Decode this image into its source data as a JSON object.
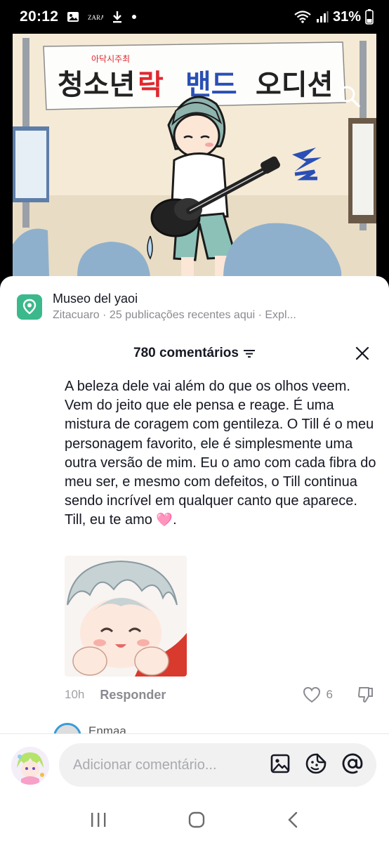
{
  "status_bar": {
    "time": "20:12",
    "battery": "31%",
    "icons": [
      "gallery-icon",
      "zara-icon",
      "download-icon",
      "dot-icon",
      "wifi-icon",
      "signal-icon",
      "battery-icon"
    ]
  },
  "video": {
    "banner_small": "아닥시주최",
    "banner_words": [
      "청소년",
      "락",
      "밴드",
      "오디션"
    ],
    "search_icon": "search-icon"
  },
  "place": {
    "title": "Museo del yaoi",
    "subtitle": "Zitacuaro · 25 publicações recentes aqui · Expl..."
  },
  "comments_header": {
    "title": "780 comentários",
    "sort_icon": "sort-icon",
    "close_icon": "close-icon"
  },
  "comment": {
    "text": "A beleza dele vai além do que os olhos veem. Vem do jeito que ele pensa e reage. É uma mistura de coragem com gentileza. O Till é o meu personagem favorito, ele é simplesmente uma outra versão de mim. Eu o amo com cada fibra do meu ser, e mesmo com defeitos, o Till continua sendo incrível em qualquer canto que aparece. Till, eu te amo ",
    "emoji": "🩷",
    "trailing": ".",
    "time": "10h",
    "reply_label": "Responder",
    "likes": "6"
  },
  "next_comment": {
    "name": "Enmaa"
  },
  "input": {
    "placeholder": "Adicionar comentário..."
  },
  "colors": {
    "accent_red": "#e0282e",
    "accent_blue": "#2a4fb5",
    "place_green": "#3bb98c",
    "text_primary": "#161823",
    "text_secondary": "#8a8b91"
  }
}
